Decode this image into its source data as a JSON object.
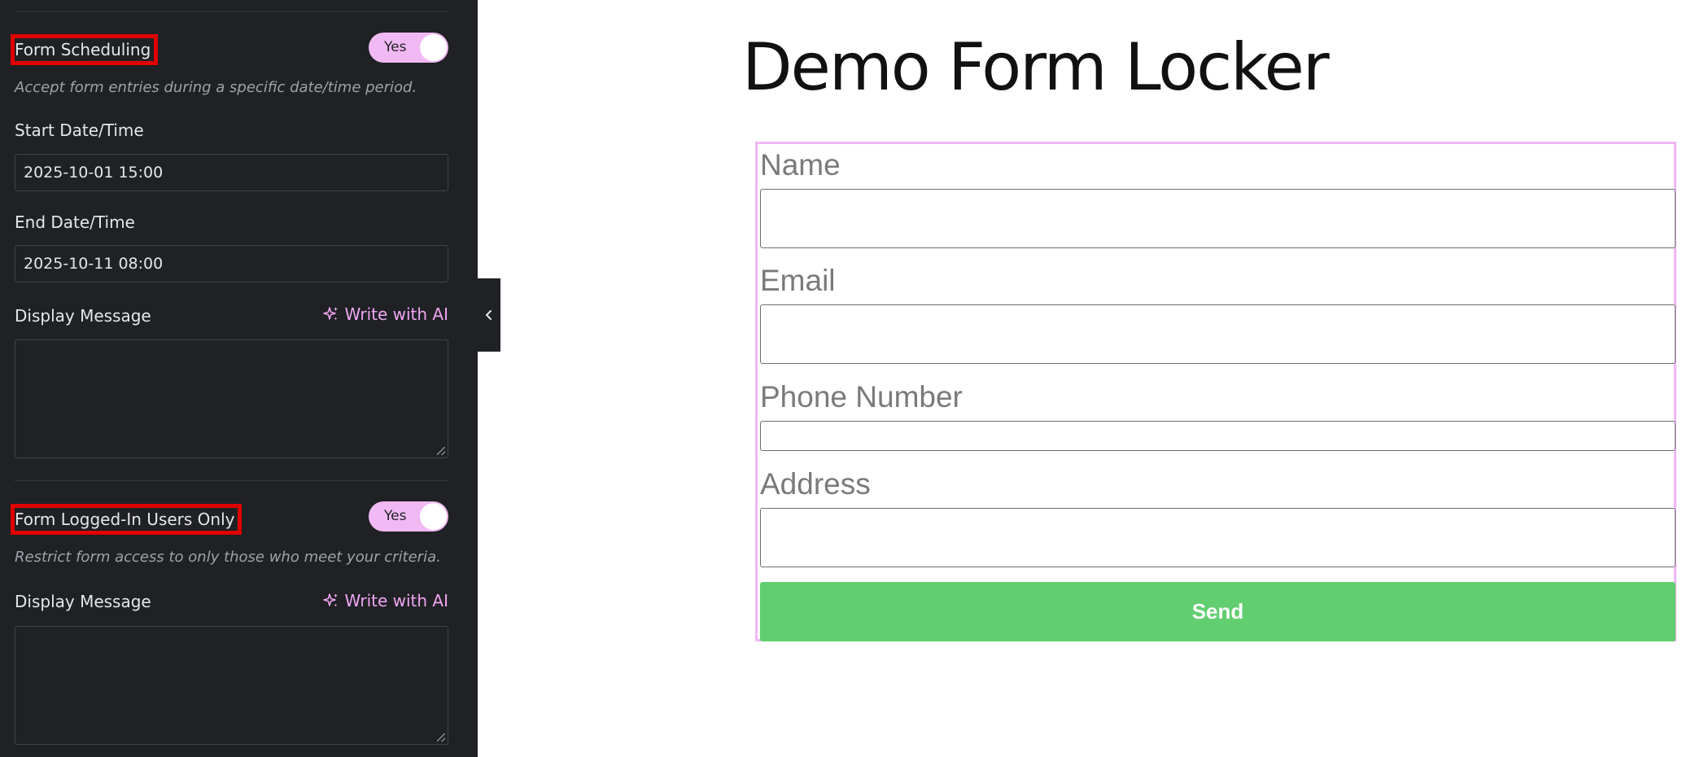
{
  "sidebar": {
    "scheduling": {
      "label": "Form Scheduling",
      "toggle": "Yes",
      "help": "Accept form entries during a specific date/time period.",
      "start_label": "Start Date/Time",
      "start_value": "2025-10-01 15:00",
      "end_label": "End Date/Time",
      "end_value": "2025-10-11 08:00",
      "message_label": "Display Message",
      "ai_label": "Write with AI",
      "message_value": ""
    },
    "logged_in": {
      "label": "Form Logged-In Users Only",
      "toggle": "Yes",
      "help": "Restrict form access to only those who meet your criteria.",
      "message_label": "Display Message",
      "ai_label": "Write with AI",
      "message_value": ""
    }
  },
  "main": {
    "title": "Demo Form Locker",
    "form": {
      "fields": [
        "Name",
        "Email",
        "Phone Number",
        "Address"
      ],
      "submit_label": "Send"
    }
  },
  "colors": {
    "sidebar_bg": "#1f2124",
    "accent": "#f1b9f3",
    "highlight_box": "#e00000",
    "submit": "#61ce70"
  },
  "icons": {
    "ai": "sparkle-icon",
    "collapse": "chevron-left-icon"
  }
}
